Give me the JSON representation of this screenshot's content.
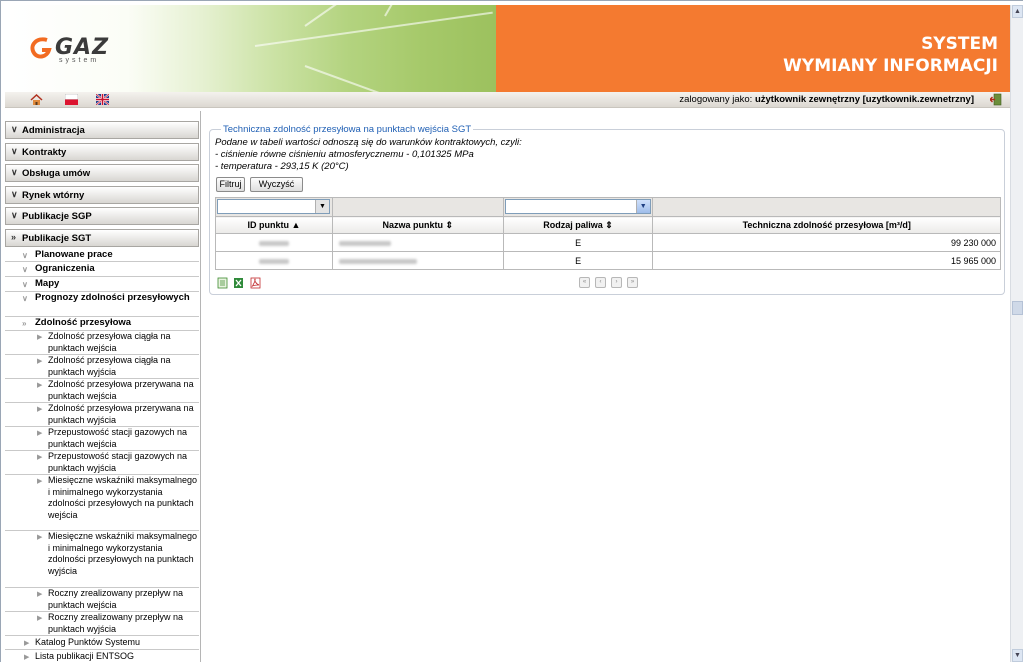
{
  "header": {
    "logo_text": "GAZ",
    "logo_sub": "system",
    "title_line1": "SYSTEM",
    "title_line2": "WYMIANY INFORMACJI"
  },
  "toolbar": {
    "icons": [
      "home-icon",
      "polish-flag-icon",
      "english-flag-icon"
    ],
    "login_label": "zalogowany jako:",
    "login_user": "użytkownik zewnętrzny [uzytkownik.zewnetrzny]",
    "exit_icon": "logout-icon"
  },
  "sidebar": {
    "main": [
      "Administracja",
      "Kontrakty",
      "Obsługa umów",
      "Rynek wtórny",
      "Publikacje SGP",
      "Publikacje SGT"
    ],
    "sub": [
      "Planowane prace",
      "Ograniczenia",
      "Mapy",
      "Prognozy zdolności przesyłowych",
      "Zdolność przesyłowa"
    ],
    "leaves": [
      "Zdolność przesyłowa ciągła na punktach wejścia",
      "Zdolność przesyłowa ciągła na punktach wyjścia",
      "Zdolność przesyłowa przerywana na punktach wejścia",
      "Zdolność przesyłowa przerywana na punktach wyjścia",
      "Przepustowość stacji gazowych na punktach wejścia",
      "Przepustowość stacji gazowych na punktach wyjścia",
      "Miesięczne wskaźniki maksymalnego i minimalnego wykorzystania zdolności przesyłowych na punktach wejścia",
      "Miesięczne wskaźniki maksymalnego i minimalnego wykorzystania zdolności przesyłowych na punktach wyjścia",
      "Roczny zrealizowany przepływ na punktach wejścia",
      "Roczny zrealizowany przepływ na punktach wyjścia"
    ],
    "bottom": [
      "Katalog Punktów Systemu",
      "Lista publikacji ENTSOG"
    ]
  },
  "panel": {
    "legend": "Techniczna zdolność przesyłowa na punktach wejścia SGT",
    "desc1": "Podane w tabeli wartości odnoszą się do warunków kontraktowych, czyli:",
    "desc2": "- ciśnienie równe ciśnieniu atmosferycznemu - 0,101325 MPa",
    "desc3": "- temperatura - 293,15 K (20°C)",
    "filter_button": "Filtruj",
    "clear_button": "Wyczyść"
  },
  "table": {
    "columns": [
      "ID punktu ▲",
      "Nazwa punktu ⇕",
      "Rodzaj paliwa ⇕",
      "Techniczna zdolność przesyłowa [m³/d]"
    ],
    "rows": [
      {
        "fuel": "E",
        "capacity": "99 230 000"
      },
      {
        "fuel": "E",
        "capacity": "15 965 000"
      }
    ],
    "export_icons": [
      "csv-export-icon",
      "excel-export-icon",
      "pdf-export-icon"
    ],
    "pager_glyphs": [
      "«",
      "‹",
      "›",
      "»"
    ]
  }
}
